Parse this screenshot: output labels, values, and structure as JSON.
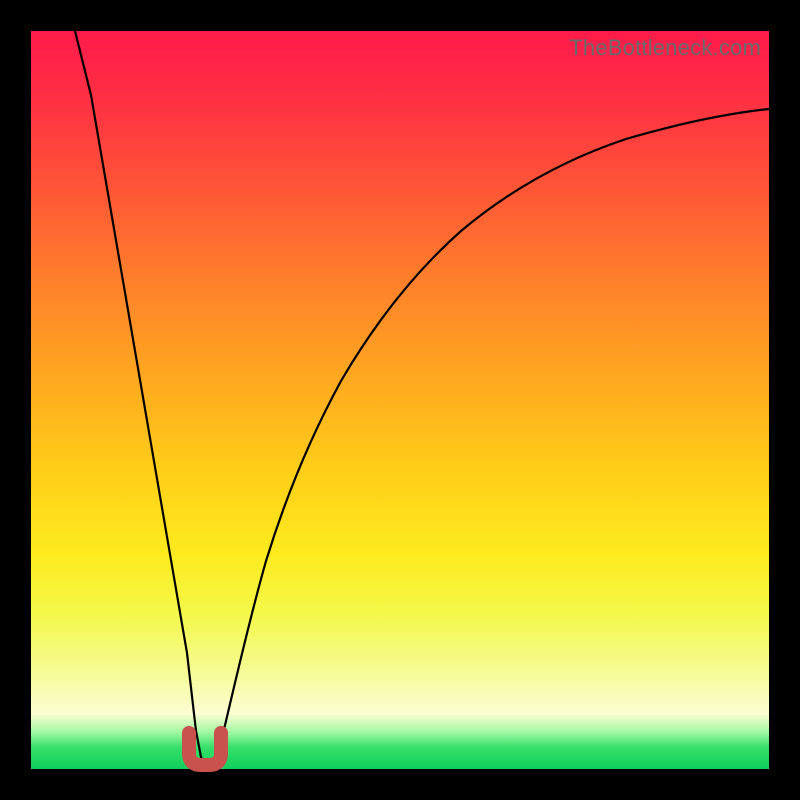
{
  "watermark": "TheBottleneck.com",
  "colors": {
    "frame_border": "#000000",
    "curve_stroke": "#000000",
    "marker_stroke": "#c9524d",
    "gradient_top": "#ff1b4b",
    "gradient_bottom": "#0fce5c"
  },
  "chart_data": {
    "type": "line",
    "title": "",
    "xlabel": "",
    "ylabel": "",
    "x": [
      0.06,
      0.08,
      0.1,
      0.12,
      0.14,
      0.16,
      0.18,
      0.2,
      0.215,
      0.23,
      0.245,
      0.26,
      0.28,
      0.3,
      0.32,
      0.36,
      0.4,
      0.45,
      0.5,
      0.55,
      0.6,
      0.65,
      0.7,
      0.75,
      0.8,
      0.85,
      0.9,
      0.95,
      1.0
    ],
    "values": [
      1.0,
      0.88,
      0.75,
      0.62,
      0.49,
      0.36,
      0.23,
      0.1,
      0.02,
      0.0,
      0.02,
      0.07,
      0.15,
      0.22,
      0.28,
      0.39,
      0.47,
      0.55,
      0.61,
      0.66,
      0.7,
      0.74,
      0.77,
      0.79,
      0.81,
      0.83,
      0.85,
      0.86,
      0.87
    ],
    "xlim": [
      0,
      1
    ],
    "ylim": [
      0,
      1
    ],
    "annotations": [
      {
        "type": "u-marker",
        "x": 0.23,
        "y": 0.0
      }
    ],
    "grid": false,
    "legend": false
  }
}
